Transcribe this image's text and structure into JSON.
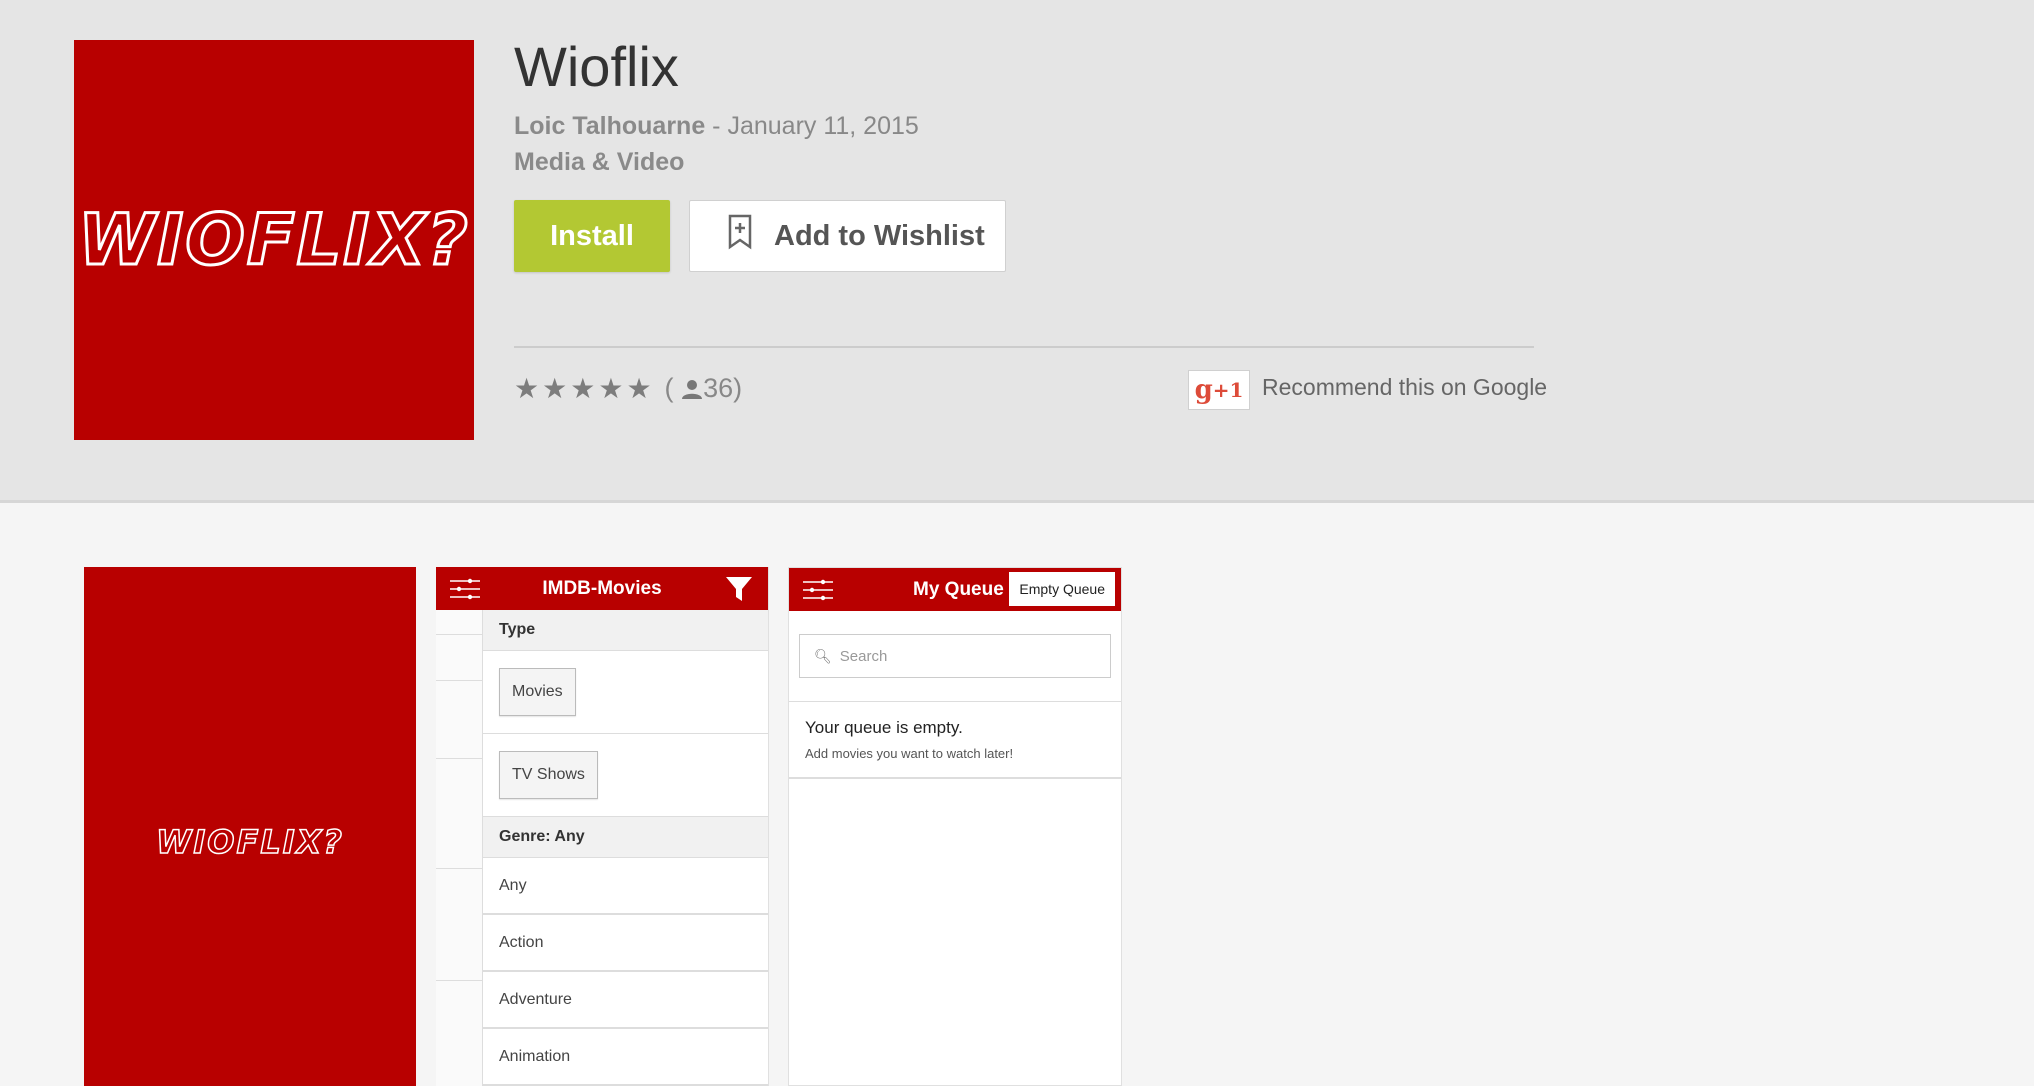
{
  "app": {
    "title": "Wioflix",
    "developer": "Loic Talhouarne",
    "date": " - January 11, 2015",
    "category": "Media & Video",
    "icon_text": "WIOFLIX?",
    "install_label": "Install",
    "wishlist_label": "Add to Wishlist",
    "rating_count": "36",
    "paren_open": "(",
    "paren_close": ")",
    "rating_stars": 5,
    "gplus_g": "g",
    "gplus_plus": "+1",
    "recommend_label": "Recommend this on Google"
  },
  "screenshots": {
    "shot1": {
      "logo": "WIOFLIX?"
    },
    "shot2": {
      "title": "IMDB-Movies",
      "type_header": "Type",
      "type_options": [
        "Movies",
        "TV Shows"
      ],
      "genre_header": "Genre: Any",
      "genres": [
        "Any",
        "Action",
        "Adventure",
        "Animation"
      ]
    },
    "shot3": {
      "title": "My Queue",
      "empty_button": "Empty Queue",
      "search_placeholder": "Search",
      "empty_title": "Your queue is empty.",
      "empty_sub": "Add movies you want to watch later!"
    }
  },
  "colors": {
    "brand_red": "#b80000",
    "install_green": "#b3c833",
    "gplus_red": "#dd4b39"
  }
}
